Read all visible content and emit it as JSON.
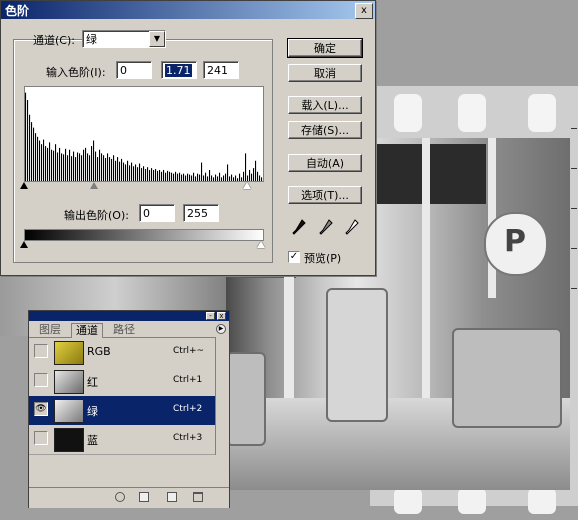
{
  "levels_dialog": {
    "title": "色阶",
    "close_label": "x",
    "channel_label": "通道(C):",
    "channel_value": "绿",
    "input_levels_label": "输入色阶(I):",
    "input_black": "0",
    "input_gamma": "1.71",
    "input_white": "241",
    "output_levels_label": "输出色阶(O):",
    "output_black": "0",
    "output_white": "255",
    "buttons": {
      "ok": "确定",
      "cancel": "取消",
      "load": "载入(L)...",
      "save": "存储(S)...",
      "auto": "自动(A)",
      "options": "选项(T)..."
    },
    "preview_label": "预览(P)",
    "preview_checked": true,
    "histogram": [
      96,
      88,
      72,
      64,
      58,
      52,
      48,
      44,
      40,
      45,
      38,
      36,
      42,
      34,
      33,
      40,
      31,
      36,
      30,
      29,
      35,
      28,
      34,
      27,
      32,
      26,
      31,
      30,
      28,
      34,
      36,
      30,
      28,
      38,
      44,
      32,
      26,
      34,
      30,
      28,
      25,
      30,
      26,
      24,
      28,
      22,
      26,
      21,
      24,
      20,
      18,
      22,
      17,
      20,
      16,
      18,
      15,
      19,
      14,
      16,
      13,
      15,
      12,
      14,
      12,
      13,
      11,
      12,
      10,
      12,
      9,
      11,
      10,
      9,
      8,
      10,
      8,
      9,
      7,
      8,
      6,
      8,
      7,
      6,
      9,
      5,
      8,
      7,
      20,
      6,
      9,
      5,
      12,
      6,
      4,
      7,
      5,
      9,
      4,
      6,
      8,
      18,
      5,
      7,
      4,
      6,
      3,
      8,
      4,
      10,
      30,
      6,
      12,
      8,
      14,
      22,
      10,
      6,
      4
    ]
  },
  "channels_palette": {
    "tabs": [
      "图层",
      "通道",
      "路径"
    ],
    "active_tab": "通道",
    "channels": [
      {
        "name": "RGB",
        "shortcut": "Ctrl+~",
        "visible": false,
        "selected": false,
        "thumb_color": "#c8b520"
      },
      {
        "name": "红",
        "shortcut": "Ctrl+1",
        "visible": false,
        "selected": false,
        "thumb_color": "#9a9a9a"
      },
      {
        "name": "绿",
        "shortcut": "Ctrl+2",
        "visible": true,
        "selected": true,
        "thumb_color": "#b0b0b0"
      },
      {
        "name": "蓝",
        "shortcut": "Ctrl+3",
        "visible": false,
        "selected": false,
        "thumb_color": "#111111"
      }
    ],
    "bottom_icons": [
      "load-selection-icon",
      "save-selection-icon",
      "new-channel-icon",
      "trash-icon"
    ]
  },
  "canvas": {
    "sign_text": "P"
  },
  "colors": {
    "title_bar": "#0a246a",
    "dialog_face": "#d4d0c8",
    "selection": "#0a246a"
  }
}
